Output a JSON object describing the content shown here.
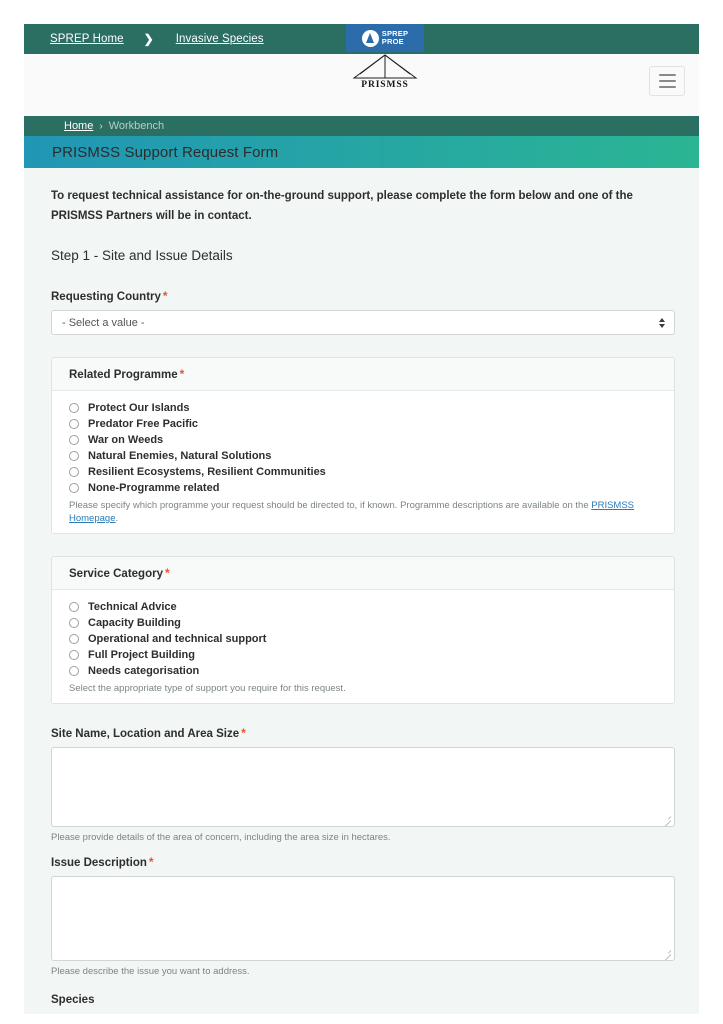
{
  "topnav": {
    "home_link": "SPREP Home",
    "separator": "❯",
    "section_link": "Invasive Species"
  },
  "logo": {
    "badge_line1": "SPREP",
    "badge_line2": "PROE",
    "wordmark": "PRISMSS"
  },
  "menu": {
    "label": "Menu"
  },
  "breadcrumb": {
    "home": "Home",
    "chevron": "›",
    "current": "Workbench"
  },
  "banner": {
    "title": "PRISMSS Support Request Form"
  },
  "form": {
    "intro": "To request technical assistance for on-the-ground support, please complete the form below and one of the PRISMSS Partners will be in contact.",
    "step_heading": "Step 1 - Site and Issue Details",
    "country": {
      "label": "Requesting Country",
      "required_marker": "*",
      "selected_value": "- Select a value -"
    },
    "programme": {
      "legend": "Related Programme",
      "required_marker": "*",
      "options": [
        "Protect Our Islands",
        "Predator Free Pacific",
        "War on Weeds",
        "Natural Enemies, Natural Solutions",
        "Resilient Ecosystems, Resilient Communities",
        "None-Programme related"
      ],
      "helper_prefix": "Please specify which programme your request should be directed to, if known. Programme descriptions are available on the ",
      "helper_link": "PRISMSS Homepage",
      "helper_suffix": "."
    },
    "service": {
      "legend": "Service Category",
      "required_marker": "*",
      "options": [
        "Technical Advice",
        "Capacity Building",
        "Operational and technical support",
        "Full Project Building",
        "Needs categorisation"
      ],
      "helper": "Select the appropriate type of support you require for this request."
    },
    "site": {
      "label": "Site Name, Location and Area Size",
      "required_marker": "*",
      "value": "",
      "helper": "Please provide details of the area of concern, including the area size in hectares."
    },
    "issue": {
      "label": "Issue Description",
      "required_marker": "*",
      "value": "",
      "helper": "Please describe the issue you want to address."
    },
    "species": {
      "label": "Species"
    }
  }
}
